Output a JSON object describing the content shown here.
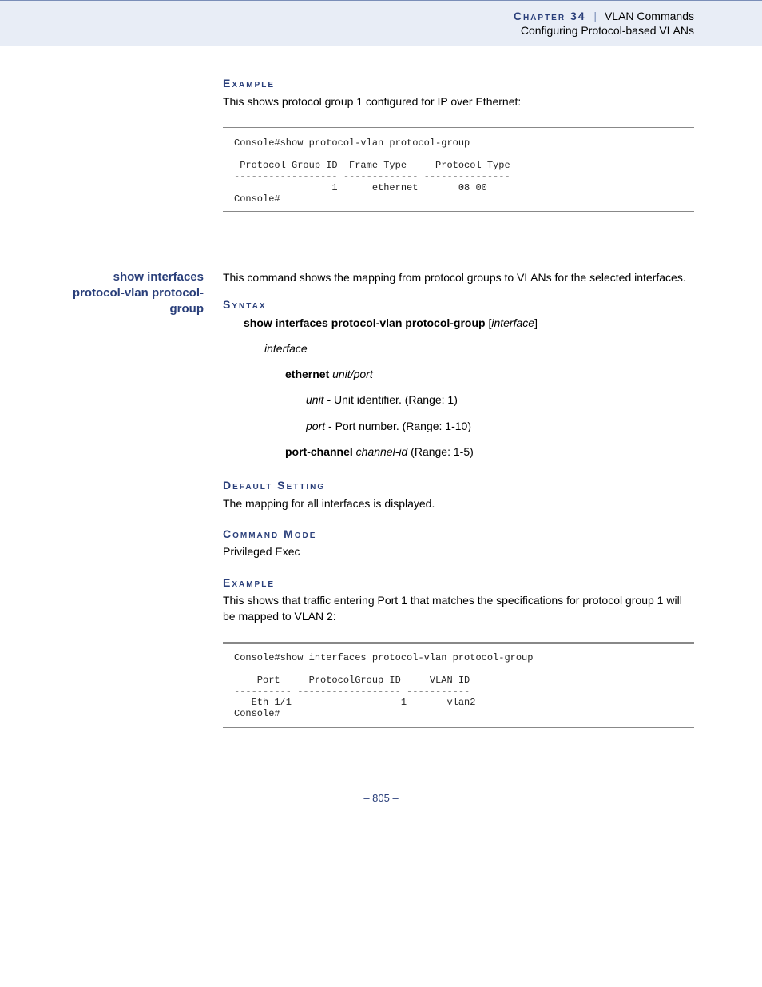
{
  "header": {
    "chapter_word": "Chapter 34",
    "pipe": "|",
    "chapter_title": "VLAN Commands",
    "subtitle": "Configuring Protocol-based VLANs"
  },
  "section1": {
    "example_head": "Example",
    "example_text": "This shows protocol group 1 configured for IP over Ethernet:",
    "code": "Console#show protocol-vlan protocol-group\n\n Protocol Group ID  Frame Type     Protocol Type\n------------------ ------------- ---------------\n                 1      ethernet       08 00\nConsole#"
  },
  "section2": {
    "left_label": "show interfaces protocol-vlan protocol-group",
    "intro": "This command shows the mapping from protocol groups to VLANs for the selected interfaces.",
    "syntax_head": "Syntax",
    "syntax": {
      "line1_bold": "show interfaces protocol-vlan protocol-group",
      "line1_rest": " [",
      "line1_it": "interface",
      "line1_end": "]",
      "interface_word": "interface",
      "eth_bold": "ethernet",
      "eth_it": " unit/port",
      "unit_it": "unit",
      "unit_desc": " - Unit identifier. (Range: 1)",
      "port_it": "port",
      "port_desc": " - Port number. (Range: 1-10)",
      "pc_bold": "port-channel",
      "pc_it": " channel-id",
      "pc_desc": " (Range: 1-5)"
    },
    "default_head": "Default Setting",
    "default_text": "The mapping for all interfaces is displayed.",
    "mode_head": "Command Mode",
    "mode_text": "Privileged Exec",
    "example_head": "Example",
    "example_text": "This shows that traffic entering Port 1 that matches the specifications for protocol group 1 will be mapped to VLAN 2:",
    "code": "Console#show interfaces protocol-vlan protocol-group\n\n    Port     ProtocolGroup ID     VLAN ID\n---------- ------------------ -----------\n   Eth 1/1                   1       vlan2\nConsole#"
  },
  "page_number": "– 805 –"
}
